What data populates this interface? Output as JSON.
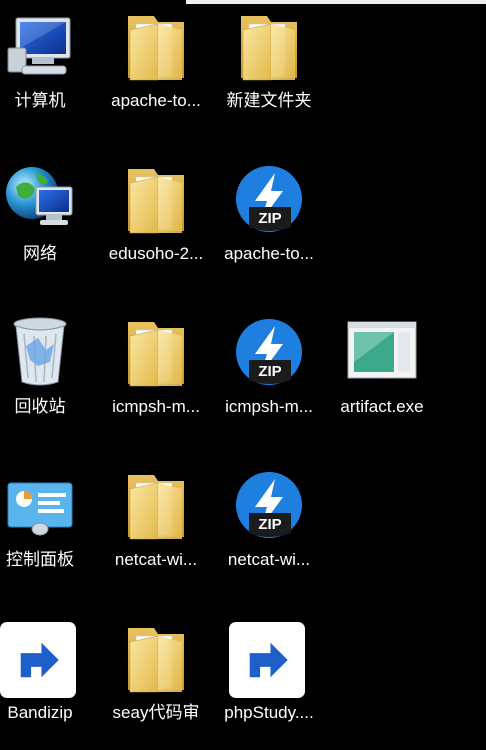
{
  "desktop": {
    "icons": [
      {
        "label": "计算机"
      },
      {
        "label": "apache-to..."
      },
      {
        "label": "新建文件夹"
      },
      {
        "label": "网络"
      },
      {
        "label": "edusoho-2..."
      },
      {
        "label": "apache-to..."
      },
      {
        "label": "回收站"
      },
      {
        "label": "icmpsh-m..."
      },
      {
        "label": "icmpsh-m..."
      },
      {
        "label": "artifact.exe"
      },
      {
        "label": "控制面板"
      },
      {
        "label": "netcat-wi..."
      },
      {
        "label": "netcat-wi..."
      },
      {
        "label": "Bandizip"
      },
      {
        "label": "seay代码审"
      },
      {
        "label": "phpStudy...."
      }
    ],
    "zip_badge": "ZIP"
  },
  "colors": {
    "background": "#000000",
    "folder": "#f3d67a",
    "bandizip_blue": "#1f7fe0"
  }
}
